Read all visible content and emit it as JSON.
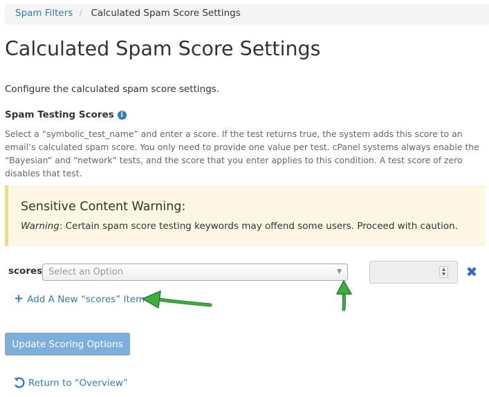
{
  "breadcrumb": {
    "parent": "Spam Filters",
    "separator": "/",
    "current": "Calculated Spam Score Settings"
  },
  "page_title": "Calculated Spam Score Settings",
  "description": "Configure the calculated spam score settings.",
  "section": {
    "title": "Spam Testing Scores",
    "info_icon": "info-circle-icon",
    "help_text": "Select a “symbolic_test_name” and enter a score. If the test returns true, the system adds this score to an email’s calculated spam score. You only need to provide one value per test. cPanel systems always enable the “Bayesian” and “network” tests, and the score that you enter applies to this condition. A test score of zero disables that test."
  },
  "warning": {
    "title": "Sensitive Content Warning:",
    "label": "Warning",
    "text": ": Certain spam score testing keywords may offend some users. Proceed with caution."
  },
  "scores": {
    "label": "scores",
    "select_placeholder": "Select an Option",
    "score_value": "",
    "remove_icon": "remove-x-icon",
    "add_label": "Add A New “scores” Item"
  },
  "update_button": "Update Scoring Options",
  "return_link": "Return to “Overview”",
  "colors": {
    "link": "#337ab7",
    "alert_bg": "#fcf8e3",
    "button": "#7eaedc",
    "annotation_arrow": "#1f8a1f"
  }
}
